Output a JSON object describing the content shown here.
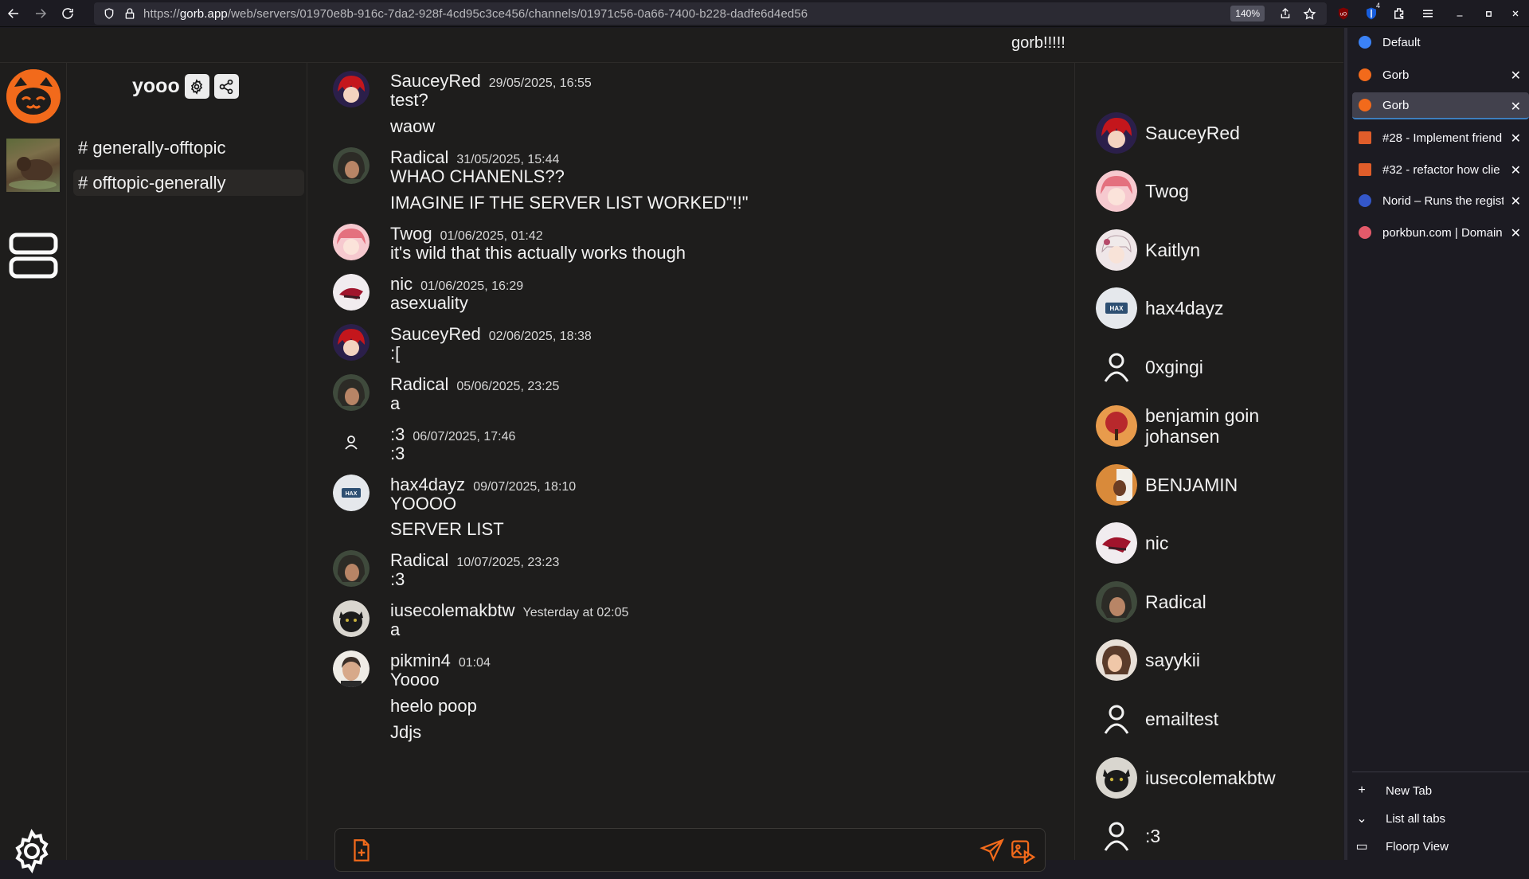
{
  "browser": {
    "url_prefix": "https://",
    "url_host": "gorb.app",
    "url_path": "/web/servers/01970e8b-916c-7da2-928f-4cd95c3ce456/channels/01971c56-0a66-7400-b228-dadfe6d4ed56",
    "zoom": "140%",
    "extension_badge": "4"
  },
  "app": {
    "title": "gorb!!!!!",
    "server_name": "yooo",
    "channels": [
      {
        "label": "# generally-offtopic",
        "active": false
      },
      {
        "label": "# offtopic-generally",
        "active": true
      }
    ]
  },
  "messages": [
    {
      "author": "SauceyRed",
      "time": "29/05/2025, 16:55",
      "lines": [
        "test?",
        "waow"
      ]
    },
    {
      "author": "Radical",
      "time": "31/05/2025, 15:44",
      "lines": [
        "WHAO CHANENLS??",
        "IMAGINE IF THE SERVER LIST WORKED\"!!\""
      ]
    },
    {
      "author": "Twog",
      "time": "01/06/2025, 01:42",
      "lines": [
        "it's wild that this actually works though"
      ]
    },
    {
      "author": "nic",
      "time": "01/06/2025, 16:29",
      "lines": [
        "asexuality"
      ]
    },
    {
      "author": "SauceyRed",
      "time": "02/06/2025, 18:38",
      "lines": [
        ":["
      ]
    },
    {
      "author": "Radical",
      "time": "05/06/2025, 23:25",
      "lines": [
        "a"
      ]
    },
    {
      "author": ":3",
      "time": "06/07/2025, 17:46",
      "lines": [
        ":3"
      ]
    },
    {
      "author": "hax4dayz",
      "time": "09/07/2025, 18:10",
      "lines": [
        "YOOOO",
        "SERVER LIST"
      ]
    },
    {
      "author": "Radical",
      "time": "10/07/2025, 23:23",
      "lines": [
        ":3"
      ]
    },
    {
      "author": "iusecolemakbtw",
      "time": "Yesterday at 02:05",
      "lines": [
        "a"
      ]
    },
    {
      "author": "pikmin4",
      "time": "01:04",
      "lines": [
        "Yoooo",
        "heelo poop",
        "Jdjs"
      ]
    }
  ],
  "members": [
    {
      "name": "SauceyRed"
    },
    {
      "name": "Twog"
    },
    {
      "name": "Kaitlyn"
    },
    {
      "name": "hax4dayz"
    },
    {
      "name": "0xgingi"
    },
    {
      "name": "benjamin goin johansen"
    },
    {
      "name": "BENJAMIN"
    },
    {
      "name": "nic"
    },
    {
      "name": "Radical"
    },
    {
      "name": "sayykii"
    },
    {
      "name": "emailtest"
    },
    {
      "name": "iusecolemakbtw"
    },
    {
      "name": ":3"
    }
  ],
  "tabs": [
    {
      "title": "Default",
      "selected": false,
      "closable": false,
      "favicon_color": "#3b82f6"
    },
    {
      "title": "Gorb",
      "selected": false,
      "closable": true,
      "favicon_color": "#f26a1b"
    },
    {
      "title": "Gorb",
      "selected": true,
      "closable": true,
      "favicon_color": "#f26a1b"
    },
    {
      "title": "#28 - Implement friend",
      "selected": false,
      "closable": true,
      "favicon_color": "#e05d2a"
    },
    {
      "title": "#32 - refactor how clie",
      "selected": false,
      "closable": true,
      "favicon_color": "#e05d2a"
    },
    {
      "title": "Norid – Runs the regist",
      "selected": false,
      "closable": true,
      "favicon_color": "#3457c9"
    },
    {
      "title": "porkbun.com | Domain",
      "selected": false,
      "closable": true,
      "favicon_color": "#e35a6a"
    }
  ],
  "tab_actions": {
    "new_tab": "New Tab",
    "list_all": "List all tabs",
    "floorp_view": "Floorp View"
  },
  "colors": {
    "accent": "#f26a1b",
    "bg": "#1e1d1c",
    "border": "#2d2b29"
  }
}
